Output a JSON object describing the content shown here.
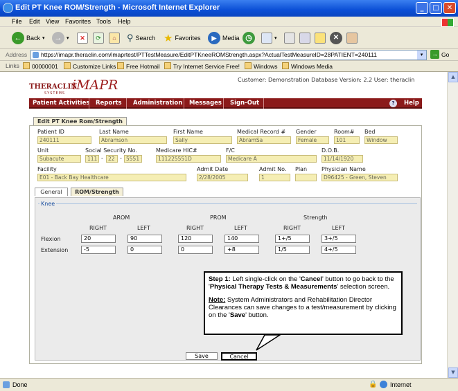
{
  "window": {
    "title": "Edit PT Knee ROM/Strength - Microsoft Internet Explorer"
  },
  "menu": [
    "File",
    "Edit",
    "View",
    "Favorites",
    "Tools",
    "Help"
  ],
  "toolbar": {
    "back": "Back",
    "search": "Search",
    "favorites": "Favorites",
    "media": "Media"
  },
  "address": {
    "label": "Address",
    "url": "https://imapr.theraclin.com/imaprtest/PTTestMeasure/EditPTKneeROMStrength.aspx?ActualTestMeasureID=28PATIENT=240111",
    "go": "Go"
  },
  "links": {
    "label": "Links",
    "items": [
      "00000001",
      "Customize Links",
      "Free Hotmail",
      "Try Internet Service Free!",
      "Windows",
      "Windows Media"
    ]
  },
  "app": {
    "logo_brand": "THERACLIN",
    "logo_sub": "SYSTEMS",
    "logo_product": "iMAPR",
    "customer_info": "Customer: Demonstration Database Version: 2.2 User: theraclin",
    "nav": [
      "Patient Activities",
      "Reports",
      "Administration",
      "Messages",
      "Sign-Out"
    ],
    "help": "Help"
  },
  "form": {
    "tab": "Edit PT Knee Rom/Strength",
    "labels": {
      "patient_id": "Patient ID",
      "last_name": "Last Name",
      "first_name": "First Name",
      "mrn": "Medical Record #",
      "gender": "Gender",
      "room": "Room#",
      "bed": "Bed",
      "unit": "Unit",
      "ssn": "Social Security No.",
      "hic": "Medicare HIC#",
      "fc": "F/C",
      "dob": "D.O.B.",
      "facility": "Facility",
      "admit_date": "Admit Date",
      "admit_no": "Admit No.",
      "plan": "Plan",
      "physician": "Physician Name"
    },
    "values": {
      "patient_id": "240111",
      "last_name": "Abramson",
      "first_name": "Sally",
      "mrn": "AbramSa",
      "gender": "Female",
      "room": "101",
      "bed": "Window",
      "unit": "Subacute",
      "ssn1": "111",
      "ssn2": "22",
      "ssn3": "5551",
      "hic": "111225551D",
      "fc": "Medicare A",
      "dob": "11/14/1920",
      "facility": "E01 - Back Bay Healthcare",
      "admit_date": "2/28/2005",
      "admit_no": "1",
      "plan": "",
      "physician": "D96425 - Green, Steven"
    }
  },
  "subtabs": [
    "General",
    "ROM/Strength"
  ],
  "knee": {
    "legend": "Knee",
    "groups": [
      "AROM",
      "PROM",
      "Strength"
    ],
    "side": [
      "RIGHT",
      "LEFT"
    ],
    "rows": [
      {
        "label": "Flexion",
        "values": [
          "20",
          "90",
          "120",
          "140",
          "1+/5",
          "3+/5"
        ]
      },
      {
        "label": "Extension",
        "values": [
          "-5",
          "0",
          "0",
          "+8",
          "1/5",
          "4+/5"
        ]
      }
    ]
  },
  "buttons": {
    "save": "Save",
    "cancel": "Cancel"
  },
  "callout": {
    "step_prefix": "Step 1:",
    "step_text_1": " Left single-click on the '",
    "step_cancel": "Cancel",
    "step_text_2": "' button to go back to the '",
    "step_screen": "Physical Therapy Tests & Measurements",
    "step_text_3": "' selection screen.",
    "note_prefix": "Note:",
    "note_text_1": " System Administrators and Rehabilitation Director Clearances can save changes to a test/measurement by clicking on the '",
    "note_save": "Save",
    "note_text_2": "' button."
  },
  "status": {
    "left": "Done",
    "zone": "Internet"
  }
}
